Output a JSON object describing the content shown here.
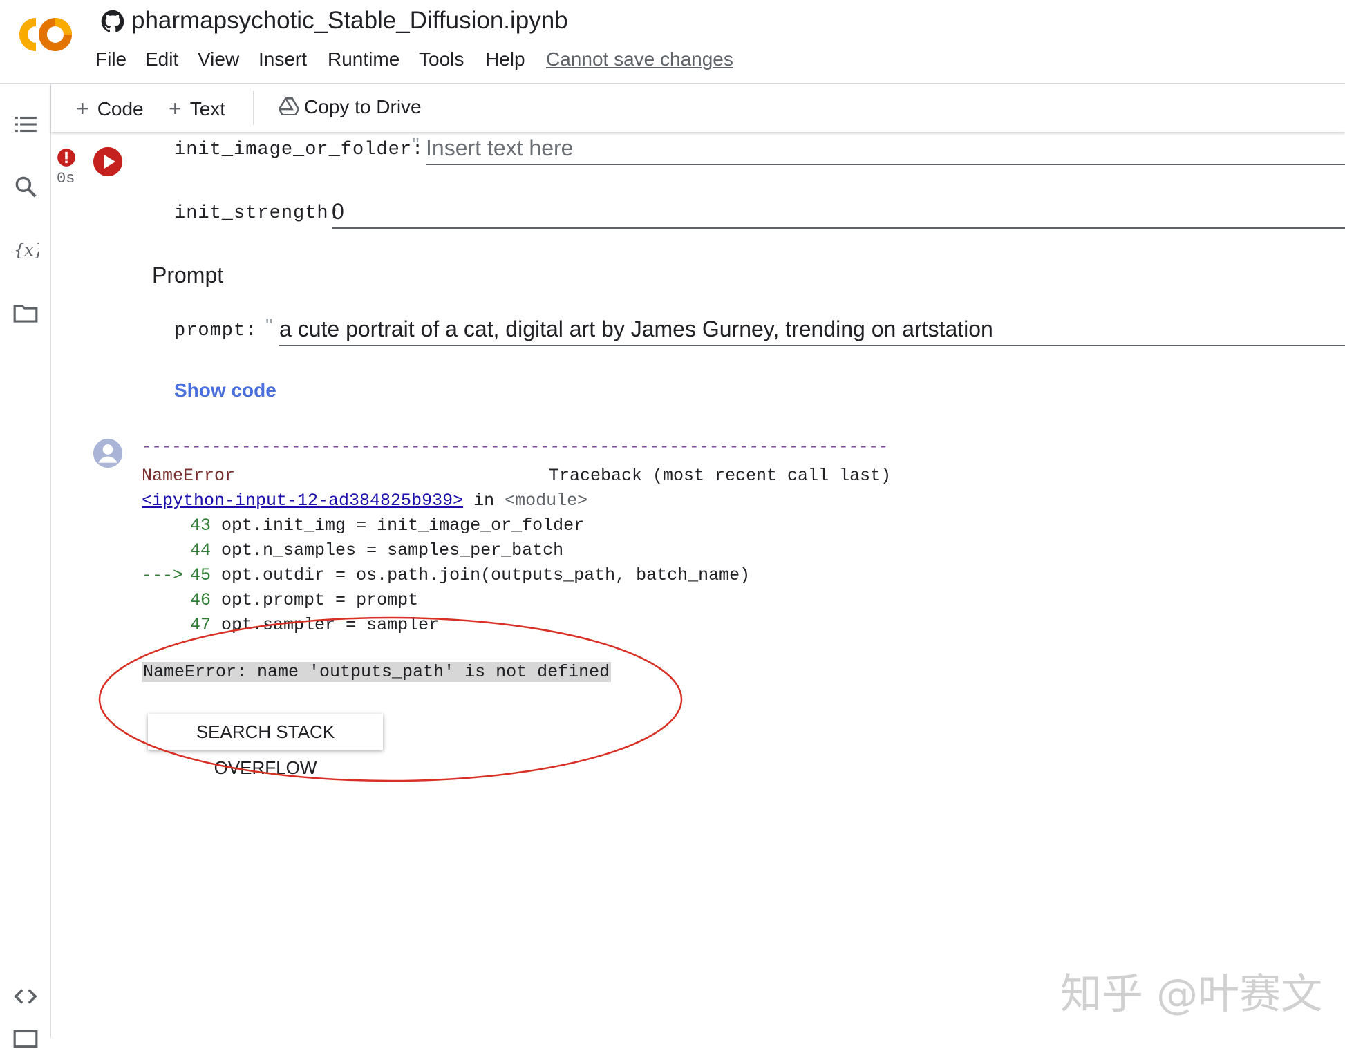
{
  "header": {
    "title": "pharmapsychotic_Stable_Diffusion.ipynb",
    "menu": [
      "File",
      "Edit",
      "View",
      "Insert",
      "Runtime",
      "Tools",
      "Help"
    ],
    "save_status": "Cannot save changes"
  },
  "toolbar": {
    "add_code": "Code",
    "add_text": "Text",
    "copy_to_drive": "Copy to Drive"
  },
  "cell": {
    "exec_time": "0s",
    "fields": {
      "init_image_or_folder": {
        "label": "init_image_or_folder:",
        "placeholder": "Insert text here"
      },
      "init_strength": {
        "label": "init_strength:",
        "value": "0"
      },
      "prompt": {
        "label": "prompt:",
        "value": "a cute portrait of a cat, digital art by James Gurney, trending on artstation"
      }
    },
    "section_heading": "Prompt",
    "show_code": "Show code"
  },
  "output": {
    "separator": "---------------------------------------------------------------------------",
    "error_name": "NameError",
    "traceback_header": "Traceback (most recent call last)",
    "source_link": "<ipython-input-12-ad384825b939>",
    "in_text": "in",
    "module_text": "<module>",
    "lines": [
      {
        "arrow": "",
        "num": "43",
        "code": "opt.init_img = init_image_or_folder"
      },
      {
        "arrow": "",
        "num": "44",
        "code": "opt.n_samples = samples_per_batch"
      },
      {
        "arrow": "--->",
        "num": "45",
        "code": "opt.outdir = os.path.join(outputs_path, batch_name)"
      },
      {
        "arrow": "",
        "num": "46",
        "code": "opt.prompt = prompt"
      },
      {
        "arrow": "",
        "num": "47",
        "code": "opt.sampler = sampler"
      }
    ],
    "error_message": "NameError: name 'outputs_path' is not defined",
    "search_button": "SEARCH STACK OVERFLOW"
  },
  "watermark": "知乎 @叶赛文",
  "colors": {
    "run_button": "#c5221f",
    "link": "#4a6fdc",
    "annotation": "#d93025",
    "error_highlight": "#d7d7d7"
  }
}
